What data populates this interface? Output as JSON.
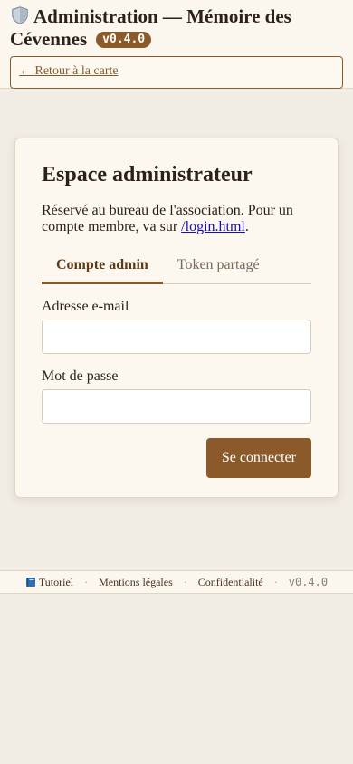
{
  "header": {
    "title": "Administration — Mémoire des Cévennes",
    "version": "v0.4.0",
    "back_link": "← Retour à la carte"
  },
  "login": {
    "heading": "Espace administrateur",
    "intro_text": "Réservé au bureau de l'association. Pour un compte membre, va sur ",
    "intro_link": "/login.html",
    "intro_end": ".",
    "tabs": [
      {
        "label": "Compte admin",
        "active": true
      },
      {
        "label": "Token partagé",
        "active": false
      }
    ],
    "email_label": "Adresse e-mail",
    "email_value": "",
    "password_label": "Mot de passe",
    "password_value": "",
    "submit_label": "Se connecter"
  },
  "footer": {
    "links": [
      "Tutoriel",
      "Mentions légales",
      "Confidentialité"
    ],
    "separator": "·",
    "version": "v0.4.0"
  },
  "colors": {
    "accent": "#8a5a2b",
    "background": "#f1ece4",
    "panel": "#fcf7ef",
    "link": "#1a0dab"
  },
  "icons": {
    "title": "shield-icon",
    "tutorial": "book-icon"
  }
}
